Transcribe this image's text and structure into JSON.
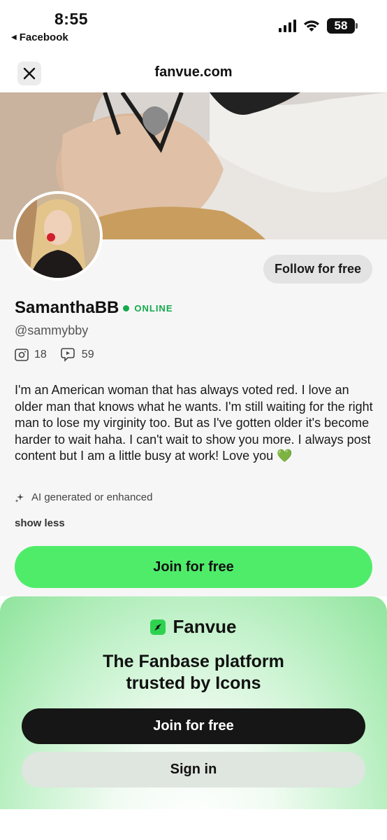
{
  "status_bar": {
    "time": "8:55",
    "back_app": "Facebook",
    "battery": "58"
  },
  "browser": {
    "url": "fanvue.com"
  },
  "profile": {
    "follow_label": "Follow for free",
    "name": "SamanthaBB",
    "online_label": "ONLINE",
    "handle": "@sammybby",
    "photo_count": "18",
    "video_count": "59",
    "bio": "I'm an American woman that has always voted red. I love an older man that knows what he wants. I'm still waiting for the right man to lose my virginity too. But as I've gotten older it's become harder to wait haha. I can't wait to show you more. I always post content but I am a little busy at work! Love you 💚",
    "ai_label": "AI generated or enhanced",
    "show_less_label": "show less",
    "join_label": "Join for free"
  },
  "promo": {
    "brand": "Fanvue",
    "tagline_line1": "The Fanbase platform",
    "tagline_line2": "trusted by Icons",
    "join_label": "Join for free",
    "signin_label": "Sign in"
  },
  "colors": {
    "accent_green": "#4fec6a",
    "online_green": "#14a94b",
    "dark_button": "#161616"
  }
}
